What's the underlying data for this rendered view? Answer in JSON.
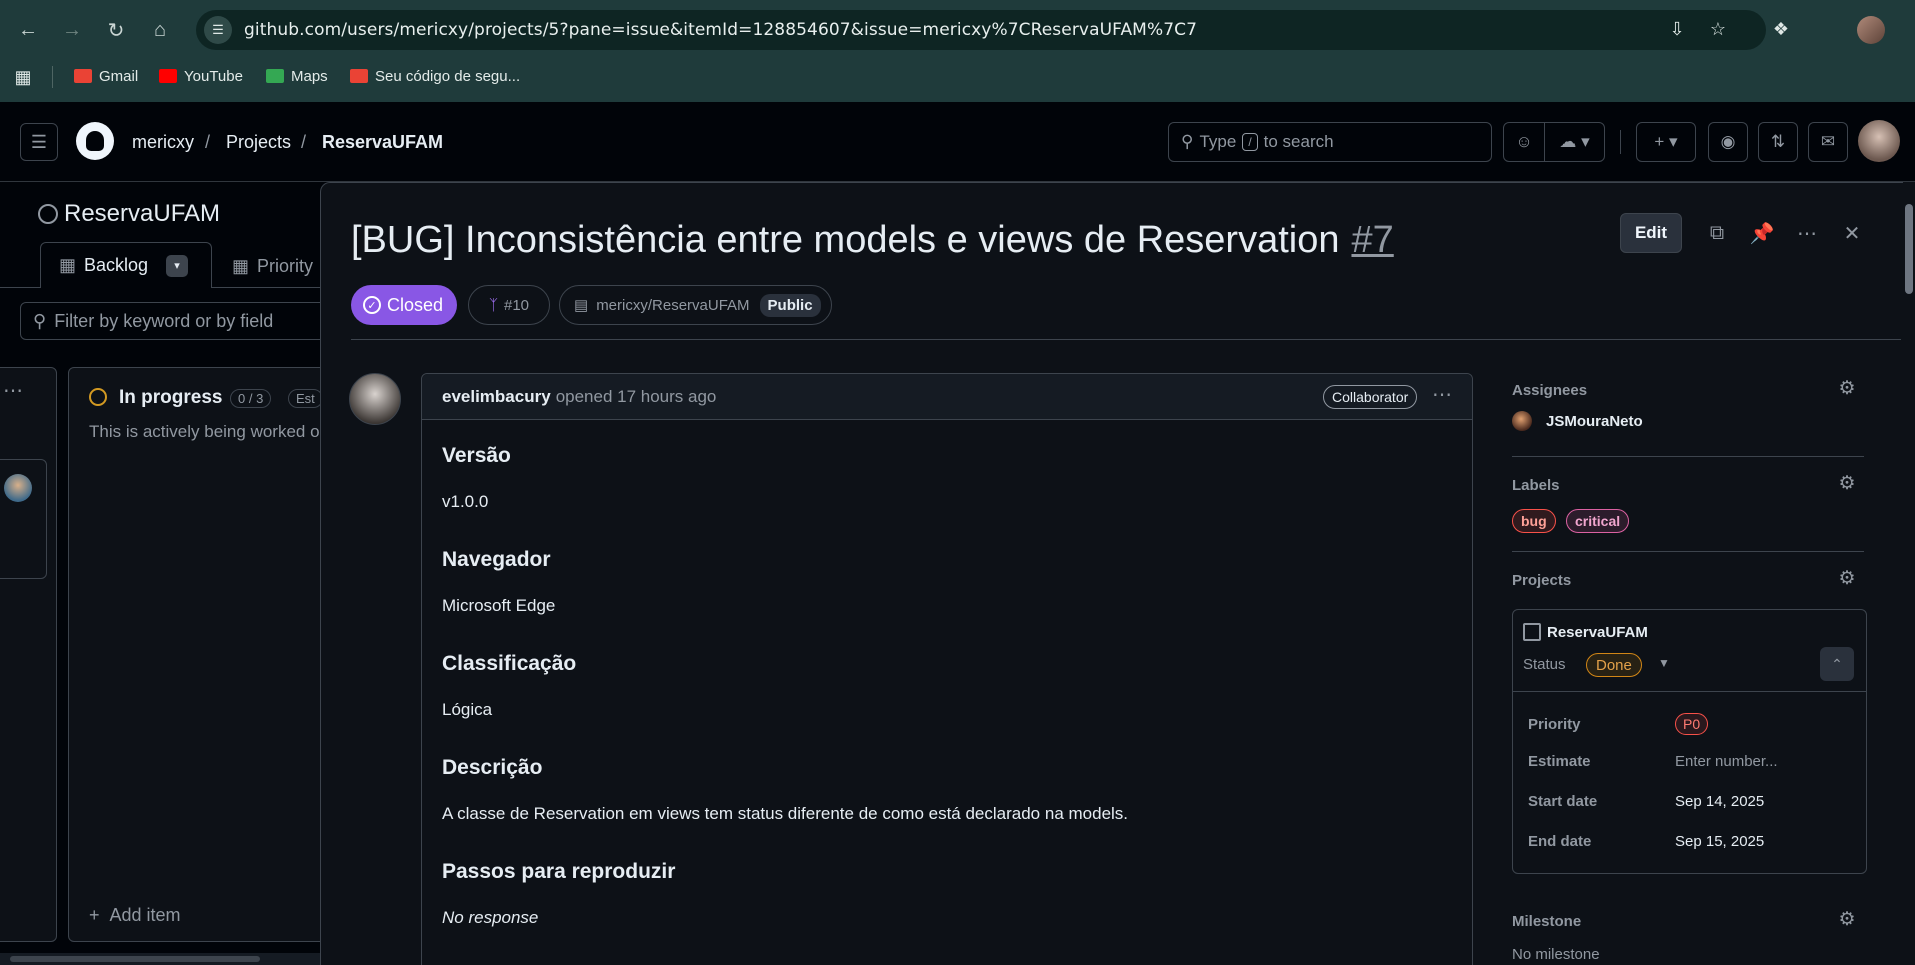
{
  "browser": {
    "url": "github.com/users/mericxy/projects/5?pane=issue&itemId=128854607&issue=mericxy%7CReservaUFAM%7C7",
    "bookmarks": [
      {
        "label": "Gmail",
        "color": "#ea4335"
      },
      {
        "label": "YouTube",
        "color": "#ff0000"
      },
      {
        "label": "Maps",
        "color": "#34a853"
      },
      {
        "label": "Seu código de segu...",
        "color": "#ea4335"
      }
    ]
  },
  "header": {
    "crumbs": [
      "mericxy",
      "/",
      "Projects",
      "/",
      "ReservaUFAM"
    ],
    "search_prefix": "Type",
    "search_key": "/",
    "search_suffix": "to search"
  },
  "board": {
    "title": "ReservaUFAM",
    "tabs": [
      "Backlog",
      "Priority"
    ],
    "filter_placeholder": "Filter by keyword or by field",
    "column": {
      "name": "In progress",
      "count": "0 / 3",
      "estimate_stub": "Est",
      "description": "This is actively being worked o",
      "add_item": "Add item"
    }
  },
  "issue": {
    "title": "[BUG] Inconsistência entre models e views de Reservation",
    "number": "#7",
    "edit_label": "Edit",
    "state": "Closed",
    "linked_pr": "#10",
    "repo": "mericxy/ReservaUFAM",
    "visibility": "Public",
    "comment": {
      "author": "evelimbacury",
      "action": "opened 17 hours ago",
      "role": "Collaborator",
      "sections": [
        {
          "heading": "Versão",
          "text": "v1.0.0"
        },
        {
          "heading": "Navegador",
          "text": "Microsoft Edge"
        },
        {
          "heading": "Classificação",
          "text": "Lógica"
        },
        {
          "heading": "Descrição",
          "text": "A classe de Reservation em views tem status diferente de como está declarado na models."
        },
        {
          "heading": "Passos para reproduzir",
          "text": "No response"
        }
      ]
    }
  },
  "sidebar": {
    "assignees_label": "Assignees",
    "assignee": "JSMouraNeto",
    "labels_label": "Labels",
    "labels": [
      {
        "name": "bug",
        "border": "#f85149",
        "text": "#ffa198"
      },
      {
        "name": "critical",
        "border": "#db61a2",
        "text": "#f2a6cf"
      }
    ],
    "projects_label": "Projects",
    "project": {
      "name": "ReservaUFAM",
      "status_label": "Status",
      "status": "Done",
      "fields": [
        {
          "key": "Priority",
          "value": "P0"
        },
        {
          "key": "Estimate",
          "value": "Enter number..."
        },
        {
          "key": "Start date",
          "value": "Sep 14, 2025"
        },
        {
          "key": "End date",
          "value": "Sep 15, 2025"
        }
      ]
    },
    "milestone_label": "Milestone",
    "milestone": "No milestone"
  }
}
